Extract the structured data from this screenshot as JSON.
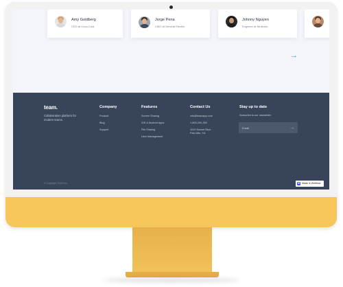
{
  "testimonials": [
    {
      "name": "Amy Goldberg",
      "role": "CEO at Coca-Cola"
    },
    {
      "name": "Jorge Pena",
      "role": "CMO at General Electric"
    },
    {
      "name": "Johnny Nguyen",
      "role": "Engineer at Nintendo"
    }
  ],
  "carousel": {
    "next_icon": "arrow-right-icon",
    "next_glyph": "→"
  },
  "footer": {
    "logo": "team.",
    "tagline": "Collaboration platform for modern teams.",
    "company": {
      "title": "Company",
      "items": [
        "Product",
        "Blog",
        "Support"
      ]
    },
    "features": {
      "title": "Features",
      "items": [
        "Screen Sharing",
        "iOS & Android Apps",
        "File Sharing",
        "User Management"
      ]
    },
    "contact": {
      "title": "Contact Us",
      "email": "info@teamapp.com",
      "phone": "1-800-200-300",
      "address_line1": "1010 Sunset Blvd.",
      "address_line2": "Palo Alto, CA"
    },
    "newsletter": {
      "title": "Stay up to date",
      "text": "Subscribe to our newsletter",
      "placeholder": "Email",
      "submit_glyph": "→"
    },
    "copyright": "© Copyright TEAM Inc.",
    "badge": {
      "icon": "W",
      "label": "Made in Webflow"
    }
  },
  "colors": {
    "footer_bg": "#374459",
    "accent": "#2f9be0",
    "monitor": "#f6c65a",
    "page_bg": "#f4f5fa"
  }
}
